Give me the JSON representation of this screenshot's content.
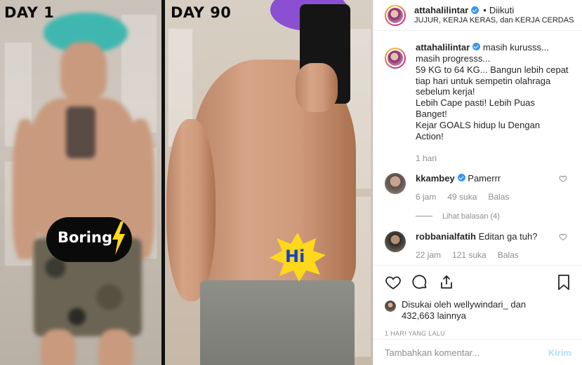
{
  "photo": {
    "day_left": "DAY 1",
    "day_right": "DAY 90",
    "sticker_left": "Boring",
    "sticker_right": "Hi"
  },
  "header": {
    "username": "attahalilintar",
    "separator": "•",
    "follow_status": "Diikuti",
    "subtitle": "JUJUR, KERJA KERAS, dan KERJA CERDAS"
  },
  "caption": {
    "username": "attahalilintar",
    "text": "masih kurusss...\nmasih progresss...\n59 KG to 64 KG... Bangun lebih cepat tiap hari untuk sempetin olahraga sebelum kerja!\nLebih Cape pasti! Lebih Puas Banget!\nKejar GOALS hidup lu Dengan Action!",
    "time": "1 hari"
  },
  "comments": [
    {
      "username": "kkambey",
      "text": "Pamerrr",
      "time": "6 jam",
      "likes": "49 suka",
      "reply": "Balas",
      "view_replies": "Lihat balasan (4)"
    },
    {
      "username": "robbanialfatih",
      "text": "Editan ga tuh?",
      "time": "22 jam",
      "likes": "121 suka",
      "reply": "Balas"
    }
  ],
  "likes": {
    "prefix": "Disukai oleh",
    "user": "wellywindari_",
    "middle": "dan",
    "count": "432,663",
    "suffix": "lainnya"
  },
  "post_time": "1 HARI YANG LALU",
  "comment_box": {
    "placeholder": "Tambahkan komentar...",
    "post_label": "Kirim"
  },
  "icons": [
    "heart-icon",
    "comment-icon",
    "share-icon",
    "bookmark-icon",
    "verified-icon",
    "lightning-icon"
  ],
  "colors": {
    "verified": "#3897f0",
    "left_hair": "#3fb7b0",
    "right_hair": "#8b4fd1",
    "hi_text": "#1443c8",
    "sticker_yellow": "#ffd81c"
  }
}
